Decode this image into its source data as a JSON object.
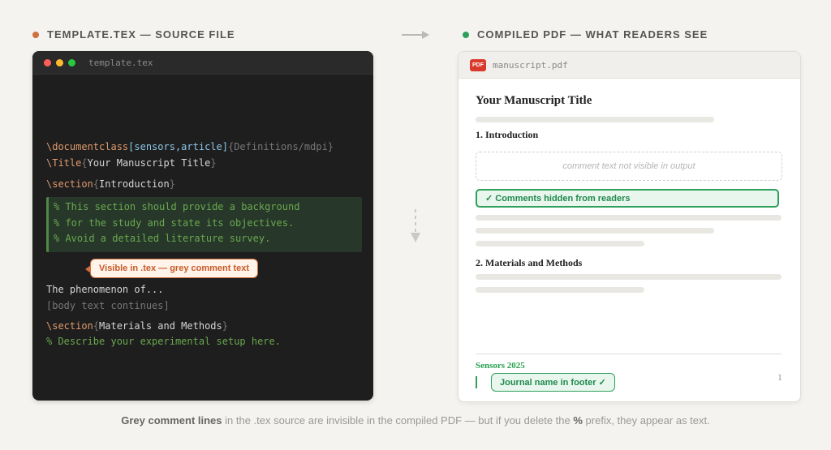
{
  "left_header": {
    "label": "TEMPLATE.TEX — SOURCE FILE",
    "dot_color": "#d0703f"
  },
  "right_header": {
    "label": "COMPILED PDF — WHAT READERS SEE",
    "dot_color": "#2ea05c"
  },
  "editor": {
    "filename": "template.tex",
    "traffic_lights": [
      "#ff5f57",
      "#febc2e",
      "#28c840"
    ],
    "line1": {
      "cmd": "\\documentclass",
      "arg": "[sensors,article]",
      "rest": "{Definitions/mdpi}"
    },
    "line2": {
      "cmd": "\\Title",
      "open": "{",
      "text": "Your Manuscript Title",
      "close": "}"
    },
    "line3": {
      "cmd": "\\section",
      "open": "{",
      "text": "Introduction",
      "close": "}"
    },
    "comments": [
      "% This section should provide a background",
      "% for the study and state its objectives.",
      "% Avoid a detailed literature survey."
    ],
    "callout": "Visible in .tex — grey comment text",
    "body1": "The phenomenon of...",
    "body2": "[body text continues]",
    "line4": {
      "cmd": "\\section",
      "open": "{",
      "text": "Materials and Methods",
      "close": "}"
    },
    "comment_last": "% Describe your experimental setup here."
  },
  "pdf": {
    "filename": "manuscript.pdf",
    "badge": "PDF",
    "title": "Your Manuscript Title",
    "section1": "1. Introduction",
    "hidden_note": "comment text not visible in output",
    "comments_hidden": "✓ Comments hidden from readers",
    "section2": "2. Materials and Methods",
    "journal": "Sensors 2025",
    "journal_pill": "Journal name in footer ✓",
    "page_number": "1"
  },
  "caption": {
    "bold1": "Grey comment lines",
    "text1": " in the .tex source are invisible in the compiled PDF — but if you delete the ",
    "bold2": "%",
    "text2": " prefix, they appear as text."
  }
}
